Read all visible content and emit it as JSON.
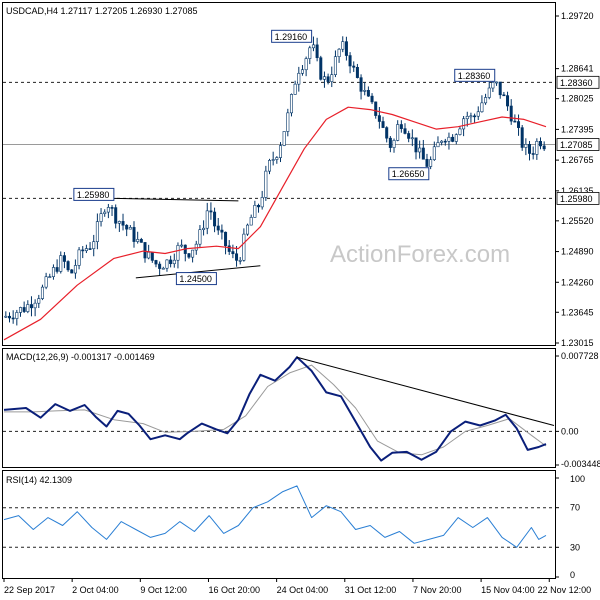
{
  "header": {
    "price": "USDCAD,H4  1.27117 1.27205 1.26930 1.27085",
    "macd": "MACD(12,26,9) -0.001317 -0.001469",
    "rsi": "RSI(14) 42.1309"
  },
  "watermark": "ActionForex.com",
  "colors": {
    "candle": "#003366",
    "ma": "#e8202a",
    "macd_line": "#0a1f7a",
    "macd_signal": "#9a9a9a",
    "rsi_line": "#2a7fd4",
    "grid": "#000000"
  },
  "chart_data": [
    {
      "type": "candlestick",
      "symbol": "USDCAD",
      "timeframe": "H4",
      "ylim": [
        1.23015,
        1.2972
      ],
      "y_ticks": [
        "1.29720",
        "1.28641",
        "1.28025",
        "1.27395",
        "1.26765",
        "1.26135",
        "1.25520",
        "1.24890",
        "1.24260",
        "1.23645",
        "1.23015"
      ],
      "highlight_ticks": [
        {
          "value": 1.2836,
          "label": "1.28360"
        },
        {
          "value": 1.27085,
          "label": "1.27085"
        },
        {
          "value": 1.2598,
          "label": "1.25980"
        }
      ],
      "x_ticks": [
        "22 Sep 2017",
        "2 Oct 04:00",
        "9 Oct 12:00",
        "16 Oct 20:00",
        "24 Oct 04:00",
        "31 Oct 12:00",
        "7 Nov 20:00",
        "15 Nov 04:00",
        "22 Nov 12:00"
      ],
      "levels": [
        {
          "value": 1.2836,
          "style": "dashed"
        },
        {
          "value": 1.2598,
          "style": "dashed"
        },
        {
          "value": 1.27085,
          "style": "solid"
        }
      ],
      "annotations": [
        {
          "label": "1.29160",
          "value": 1.2916
        },
        {
          "label": "1.28360",
          "value": 1.2836
        },
        {
          "label": "1.26650",
          "value": 1.2665
        },
        {
          "label": "1.25980",
          "value": 1.2598
        },
        {
          "label": "1.24500",
          "value": 1.245
        }
      ],
      "path_points": [
        [
          0,
          1.2355
        ],
        [
          6,
          1.2375
        ],
        [
          10,
          1.2405
        ],
        [
          14,
          1.2455
        ],
        [
          16,
          1.2475
        ],
        [
          18,
          1.2438
        ],
        [
          21,
          1.2488
        ],
        [
          24,
          1.2505
        ],
        [
          26,
          1.2548
        ],
        [
          28,
          1.2595
        ],
        [
          30,
          1.2565
        ],
        [
          33,
          1.254
        ],
        [
          36,
          1.2515
        ],
        [
          39,
          1.2482
        ],
        [
          42,
          1.246
        ],
        [
          45,
          1.247
        ],
        [
          48,
          1.25
        ],
        [
          50,
          1.2485
        ],
        [
          53,
          1.251
        ],
        [
          56,
          1.2585
        ],
        [
          58,
          1.253
        ],
        [
          60,
          1.251
        ],
        [
          62,
          1.248
        ],
        [
          64,
          1.247
        ],
        [
          67,
          1.2552
        ],
        [
          70,
          1.259
        ],
        [
          72,
          1.266
        ],
        [
          75,
          1.27
        ],
        [
          78,
          1.278
        ],
        [
          80,
          1.286
        ],
        [
          82,
          1.288
        ],
        [
          84,
          1.2916
        ],
        [
          86,
          1.286
        ],
        [
          88,
          1.2835
        ],
        [
          90,
          1.287
        ],
        [
          92,
          1.2912
        ],
        [
          94,
          1.289
        ],
        [
          96,
          1.285
        ],
        [
          98,
          1.282
        ],
        [
          100,
          1.279
        ],
        [
          102,
          1.277
        ],
        [
          104,
          1.273
        ],
        [
          106,
          1.27
        ],
        [
          108,
          1.276
        ],
        [
          110,
          1.274
        ],
        [
          112,
          1.271
        ],
        [
          114,
          1.268
        ],
        [
          116,
          1.2665
        ],
        [
          118,
          1.27
        ],
        [
          120,
          1.273
        ],
        [
          122,
          1.272
        ],
        [
          124,
          1.2745
        ],
        [
          126,
          1.277
        ],
        [
          128,
          1.276
        ],
        [
          130,
          1.279
        ],
        [
          132,
          1.281
        ],
        [
          134,
          1.2836
        ],
        [
          136,
          1.281
        ],
        [
          138,
          1.278
        ],
        [
          140,
          1.274
        ],
        [
          142,
          1.27
        ],
        [
          144,
          1.269
        ],
        [
          146,
          1.272
        ],
        [
          148,
          1.2708
        ]
      ],
      "ma_points": [
        [
          0,
          1.2308
        ],
        [
          10,
          1.235
        ],
        [
          20,
          1.242
        ],
        [
          30,
          1.2475
        ],
        [
          38,
          1.249
        ],
        [
          44,
          1.2485
        ],
        [
          50,
          1.2495
        ],
        [
          58,
          1.25
        ],
        [
          64,
          1.2495
        ],
        [
          70,
          1.254
        ],
        [
          76,
          1.262
        ],
        [
          82,
          1.27
        ],
        [
          88,
          1.276
        ],
        [
          94,
          1.2785
        ],
        [
          100,
          1.278
        ],
        [
          106,
          1.277
        ],
        [
          112,
          1.2755
        ],
        [
          118,
          1.274
        ],
        [
          124,
          1.2745
        ],
        [
          130,
          1.2755
        ],
        [
          136,
          1.2765
        ],
        [
          142,
          1.276
        ],
        [
          148,
          1.2745
        ]
      ],
      "trend_lines": [
        {
          "from": [
            30,
            1.2598
          ],
          "to": [
            64,
            1.2593
          ]
        },
        {
          "from": [
            36,
            1.2435
          ],
          "to": [
            70,
            1.246
          ]
        }
      ],
      "n_candles": 148
    },
    {
      "type": "line",
      "title": "MACD(12,26,9) -0.001317 -0.001469",
      "ylim": [
        -0.003448,
        0.007728
      ],
      "y_ticks": [
        "0.007728",
        "0.00",
        "-0.003448"
      ],
      "zero_label": "0.00",
      "series": [
        {
          "values": [
            [
              0,
              0.0022
            ],
            [
              6,
              0.0024
            ],
            [
              10,
              0.0014
            ],
            [
              14,
              0.0028
            ],
            [
              18,
              0.0021
            ],
            [
              22,
              0.0027
            ],
            [
              25,
              0.0015
            ],
            [
              28,
              0.0005
            ],
            [
              31,
              0.0021
            ],
            [
              34,
              0.0018
            ],
            [
              37,
              0.0006
            ],
            [
              40,
              -0.0008
            ],
            [
              44,
              -0.0004
            ],
            [
              48,
              -0.0008
            ],
            [
              50,
              -0.0002
            ],
            [
              54,
              0.0008
            ],
            [
              58,
              0.0002
            ],
            [
              61,
              -0.0002
            ],
            [
              64,
              0.0012
            ],
            [
              67,
              0.0038
            ],
            [
              70,
              0.0058
            ],
            [
              74,
              0.0052
            ],
            [
              78,
              0.0066
            ],
            [
              80,
              0.0076
            ],
            [
              84,
              0.0062
            ],
            [
              88,
              0.004
            ],
            [
              92,
              0.0036
            ],
            [
              96,
              0.001
            ],
            [
              100,
              -0.0016
            ],
            [
              103,
              -0.003
            ],
            [
              106,
              -0.0022
            ],
            [
              110,
              -0.0021
            ],
            [
              114,
              -0.0029
            ],
            [
              118,
              -0.0021
            ],
            [
              122,
              0.0
            ],
            [
              126,
              0.001
            ],
            [
              130,
              0.0006
            ],
            [
              134,
              0.0011
            ],
            [
              137,
              0.0017
            ],
            [
              140,
              0.0003
            ],
            [
              143,
              -0.0019
            ],
            [
              146,
              -0.0016
            ],
            [
              148,
              -0.0013
            ]
          ]
        },
        {
          "values": [
            [
              0,
              0.002
            ],
            [
              8,
              0.002
            ],
            [
              14,
              0.0021
            ],
            [
              22,
              0.0022
            ],
            [
              30,
              0.0012
            ],
            [
              38,
              0.0008
            ],
            [
              44,
              -0.0001
            ],
            [
              52,
              0.0
            ],
            [
              60,
              0.0002
            ],
            [
              66,
              0.0016
            ],
            [
              72,
              0.0046
            ],
            [
              78,
              0.006
            ],
            [
              84,
              0.0068
            ],
            [
              90,
              0.0048
            ],
            [
              96,
              0.0024
            ],
            [
              102,
              -0.001
            ],
            [
              108,
              -0.0022
            ],
            [
              114,
              -0.0024
            ],
            [
              120,
              -0.0016
            ],
            [
              126,
              0.0
            ],
            [
              132,
              0.0006
            ],
            [
              138,
              0.0013
            ],
            [
              144,
              -0.0004
            ],
            [
              148,
              -0.0015
            ]
          ]
        }
      ],
      "trend_line": {
        "from": [
          80,
          0.0076
        ],
        "to": [
          148,
          0.0006
        ]
      }
    },
    {
      "type": "line",
      "title": "RSI(14) 42.1309",
      "ylim": [
        0,
        100
      ],
      "y_ticks": [
        "100",
        "70",
        "30",
        "0"
      ],
      "levels": [
        70,
        30
      ],
      "series": [
        {
          "values": [
            [
              0,
              58
            ],
            [
              4,
              62
            ],
            [
              8,
              48
            ],
            [
              12,
              60
            ],
            [
              16,
              52
            ],
            [
              20,
              66
            ],
            [
              24,
              50
            ],
            [
              28,
              38
            ],
            [
              32,
              56
            ],
            [
              36,
              48
            ],
            [
              40,
              40
            ],
            [
              44,
              44
            ],
            [
              48,
              56
            ],
            [
              52,
              46
            ],
            [
              56,
              62
            ],
            [
              60,
              44
            ],
            [
              64,
              52
            ],
            [
              68,
              70
            ],
            [
              72,
              76
            ],
            [
              76,
              86
            ],
            [
              80,
              92
            ],
            [
              84,
              60
            ],
            [
              88,
              72
            ],
            [
              92,
              66
            ],
            [
              96,
              48
            ],
            [
              100,
              52
            ],
            [
              104,
              40
            ],
            [
              108,
              46
            ],
            [
              112,
              34
            ],
            [
              116,
              38
            ],
            [
              120,
              42
            ],
            [
              124,
              60
            ],
            [
              128,
              50
            ],
            [
              132,
              60
            ],
            [
              136,
              40
            ],
            [
              140,
              30
            ],
            [
              144,
              50
            ],
            [
              146,
              38
            ],
            [
              148,
              42
            ]
          ]
        }
      ]
    }
  ]
}
